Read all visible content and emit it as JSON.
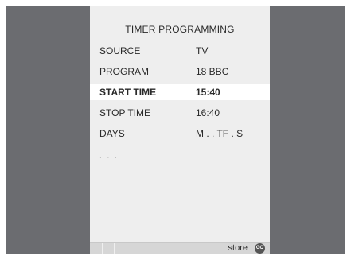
{
  "menu": {
    "title": "TIMER  PROGRAMMING",
    "rows": [
      {
        "label": "SOURCE",
        "value": "TV"
      },
      {
        "label": "PROGRAM",
        "value": "18  BBC"
      },
      {
        "label": "START TIME",
        "value": "15:40"
      },
      {
        "label": "STOP TIME",
        "value": "16:40"
      },
      {
        "label": "DAYS",
        "value": "M . . TF . S"
      }
    ],
    "selected_row": "START TIME",
    "more_indicator": ". . ."
  },
  "footer": {
    "store_label": "store",
    "go_icon": "go-button-icon",
    "go_text": "GO"
  },
  "colors": {
    "background": "#6b6c70",
    "panel": "#eeeeee",
    "selected_row": "#ffffff",
    "text": "#2a2a2a",
    "footer": "#d6d6d6"
  }
}
